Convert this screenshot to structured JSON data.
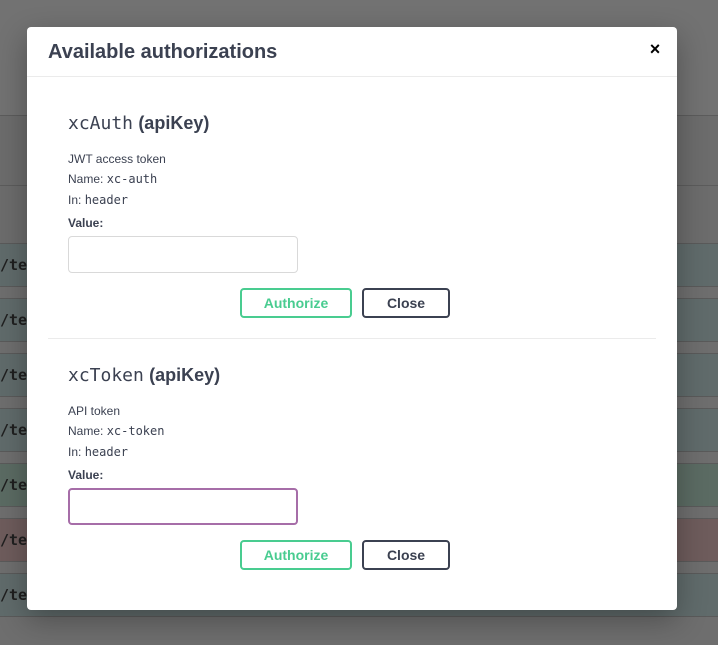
{
  "background": {
    "rows": [
      {
        "path": "/te",
        "color": "#5f6a6a"
      },
      {
        "path": "/te",
        "color": "#5f6a6a"
      },
      {
        "path": "/te",
        "color": "#5f6a6a"
      },
      {
        "path": "/te",
        "color": "#5f6a6a"
      },
      {
        "path": "/te",
        "color": "#5b6b63"
      },
      {
        "path": "/te",
        "color": "#6e5b5b"
      },
      {
        "path": "/te",
        "color": "#5f6a6a"
      }
    ]
  },
  "modal": {
    "title": "Available authorizations",
    "close_glyph": "×"
  },
  "auths": [
    {
      "name": "xcAuth",
      "type": "(apiKey)",
      "description": "JWT access token",
      "name_label": "Name:",
      "name_value": "xc-auth",
      "in_label": "In:",
      "in_value": "header",
      "value_label": "Value:",
      "value": "",
      "authorize_label": "Authorize",
      "close_label": "Close"
    },
    {
      "name": "xcToken",
      "type": "(apiKey)",
      "description": "API token",
      "name_label": "Name:",
      "name_value": "xc-token",
      "in_label": "In:",
      "in_value": "header",
      "value_label": "Value:",
      "value": "",
      "authorize_label": "Authorize",
      "close_label": "Close"
    }
  ],
  "colors": {
    "authorize": "#49cc90",
    "close": "#3b4151",
    "focus": "#a66da8"
  }
}
